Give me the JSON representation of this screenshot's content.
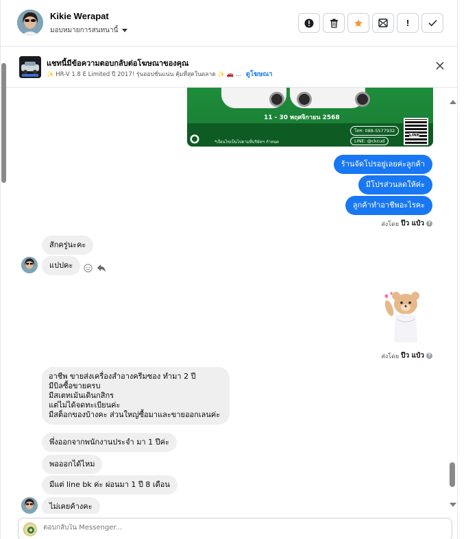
{
  "header": {
    "contact_name": "Kikie Werapat",
    "assign_label": "มอบหมายการสนทนานี้",
    "actions": [
      {
        "icon": "alert-circle-icon",
        "glyph": "!"
      },
      {
        "icon": "trash-icon"
      },
      {
        "icon": "star-icon"
      },
      {
        "icon": "mail-archive-icon"
      },
      {
        "icon": "exclamation-icon",
        "glyph": "!"
      },
      {
        "icon": "check-icon",
        "glyph": "✓"
      }
    ],
    "colors": {
      "star": "#f7923b"
    }
  },
  "ad_banner": {
    "title": "แชทนี้มีข้อความตอบกลับต่อโฆษณาของคุณ",
    "subtitle": "✨ HR-V 1.8 E Limited ปี 2017! รุ่นออปชั่นแน่น คุ้มที่สุดในตลาด ✨ 🚗 ...",
    "link": "ดูโฆษณา"
  },
  "ad_image": {
    "date_text": "11 - 30 พฤศจิกายน 2568",
    "phone": "โทร: 088-5577932",
    "line": "LINE: @ckcud",
    "footnote": "*เงื่อนไขเป็นไปตามที่บริษัทฯ กำหนด",
    "qr_label": "LINE"
  },
  "messages": {
    "out_1": "ร้านจัดโปรอยู่เลยค่ะลูกค้า",
    "out_2": "มีโปรส่วนลดให้ค่ะ",
    "out_3": "ลูกค้าทำอาชีพอะไรคะ",
    "sent_by_label": "ส่งโดย",
    "sent_by_name": "ป๊ว แป๋ว",
    "in_1": "สักครู่นะคะ",
    "in_2": "แปปคะ",
    "in_3_lines": [
      "อาชีพ ขายส่งเครื่องสำอางครีมซอง ทำมา 2 ปี",
      "มีบิลซื้อขายครบ",
      "มีสเตทเม้นเดินกสิกร",
      "แต่ไม่ได้จดทะเบียนค่ะ",
      "มีสต็อกของบ้างคะ ส่วนใหญ่ซื้อมาและขายออกเลนค่ะ"
    ],
    "in_4": "พึ่งออกจากพนักงานประจำ มา 1 ปีค่ะ",
    "in_5": "พอออกได้ไหม",
    "in_6": "มีแต่ line bk ค่ะ ผ่อนมา 1 ปี 8 เดือน",
    "in_7": "ไม่เคยค้างคะ"
  },
  "composer": {
    "placeholder": "ตอบกลับใน Messenger..."
  }
}
